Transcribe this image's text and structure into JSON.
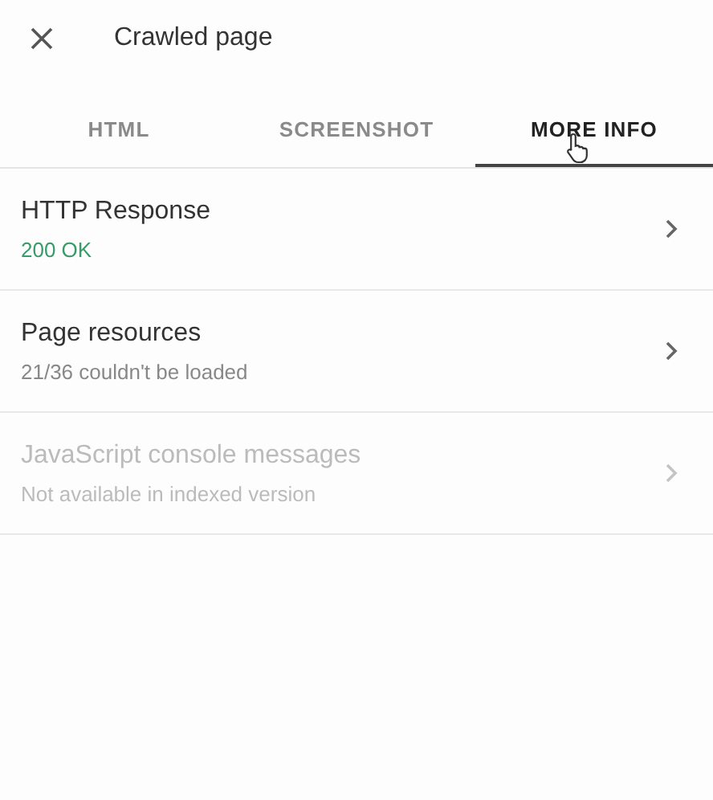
{
  "header": {
    "title": "Crawled page"
  },
  "tabs": [
    {
      "label": "HTML",
      "selected": false
    },
    {
      "label": "SCREENSHOT",
      "selected": false
    },
    {
      "label": "MORE INFO",
      "selected": true
    }
  ],
  "items": [
    {
      "title": "HTTP Response",
      "subtitle": "200 OK",
      "kind": "success",
      "disabled": false
    },
    {
      "title": "Page resources",
      "subtitle": "21/36 couldn't be loaded",
      "kind": "plain",
      "disabled": false
    },
    {
      "title": "JavaScript console messages",
      "subtitle": "Not available in indexed version",
      "kind": "plain",
      "disabled": true
    }
  ]
}
